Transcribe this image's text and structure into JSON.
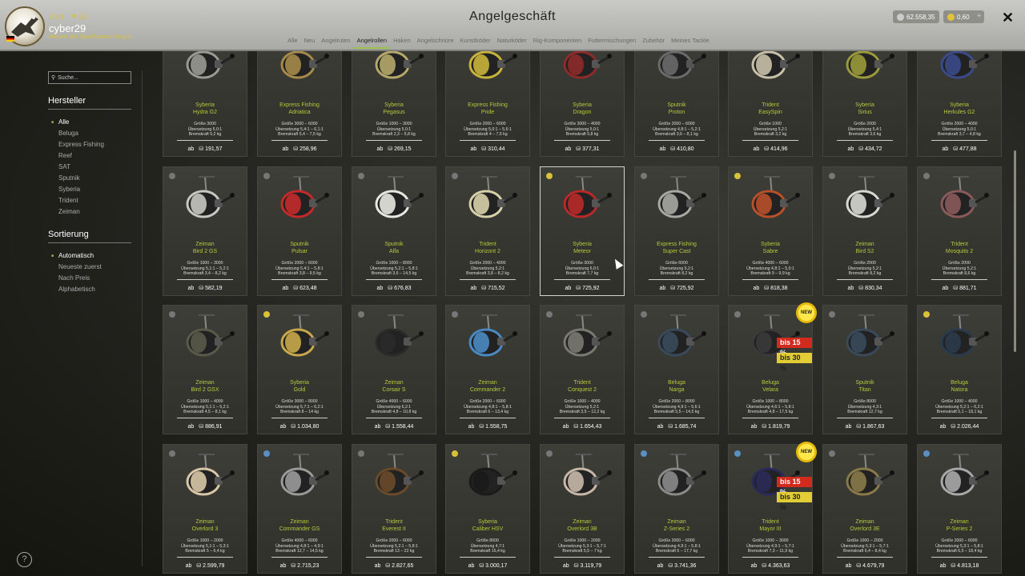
{
  "header": {
    "title": "Angelgeschäft",
    "user": {
      "name": "cyber29",
      "level": "41",
      "stars": "50",
      "rank": "Meister des Spinnfischen Rang 2"
    },
    "tabs": [
      "Alle",
      "Neu",
      "Angelruten",
      "Angelrollen",
      "Haken",
      "Angelschnüre",
      "Kunstköder",
      "Naturköder",
      "Rig-Komponenten",
      "Futtermischungen",
      "Zubehör",
      "Meines Tackle"
    ],
    "active_tab": "Angelrollen",
    "silver": "62.558,35",
    "gold": "0,60",
    "plus": "+",
    "close": "✕"
  },
  "sidebar": {
    "search_placeholder": "Suche...",
    "manufacturer_title": "Hersteller",
    "manufacturers": [
      "Alle",
      "Beluga",
      "Express Fishing",
      "Reef",
      "SAT",
      "Sputnik",
      "Syberia",
      "Trident",
      "Zeiman"
    ],
    "manufacturer_active": "Alle",
    "sort_title": "Sortierung",
    "sort_options": [
      "Automatisch",
      "Neueste zuerst",
      "Nach Preis",
      "Alphabetisch"
    ],
    "sort_active": "Automatisch",
    "help": "?"
  },
  "price_prefix": "ab",
  "discounts": {
    "d15": "bis 15 %",
    "d30": "bis 30 %",
    "new": "NEW"
  },
  "cards": [
    {
      "brand": "Syberia",
      "model": "Hydra G2",
      "size": "Größe 3000",
      "ratio": "Übersetzung 5,0:1",
      "drag": "Bremskraft 5,2 kg",
      "price": "191,57",
      "reel": "#9a9a94",
      "badge": ""
    },
    {
      "brand": "Express Fishing",
      "model": "Adriatica",
      "size": "Größe 3000 – 6000",
      "ratio": "Übersetzung 5,4:1 – 6,1:1",
      "drag": "Bremskraft 5,4 – 7,5 kg",
      "price": "258,96",
      "reel": "#a58a4a",
      "badge": ""
    },
    {
      "brand": "Syberia",
      "model": "Pegasus",
      "size": "Größe 1000 – 3000",
      "ratio": "Übersetzung 5,0:1",
      "drag": "Bremskraft 2,3 – 5,8 kg",
      "price": "269,15",
      "reel": "#b5a86a",
      "badge": ""
    },
    {
      "brand": "Express Fishing",
      "model": "Pride",
      "size": "Größe 2000 – 6000",
      "ratio": "Übersetzung 5,0:1 – 5,6:1",
      "drag": "Bremskraft 4 – 7,5 kg",
      "price": "310,44",
      "reel": "#c8b43a",
      "badge": ""
    },
    {
      "brand": "Syberia",
      "model": "Dragon",
      "size": "Größe 3000 – 4000",
      "ratio": "Übersetzung 5,0:1",
      "drag": "Bremskraft 5,8 kg",
      "price": "377,31",
      "reel": "#8e2a2a",
      "badge": ""
    },
    {
      "brand": "Sputnik",
      "model": "Proton",
      "size": "Größe 2000 – 6000",
      "ratio": "Übersetzung 4,8:1 – 5,2:1",
      "drag": "Bremskraft 3,6 – 8,1 kg",
      "price": "410,80",
      "reel": "#6a6a6a",
      "badge": ""
    },
    {
      "brand": "Trident",
      "model": "EasySpin",
      "size": "Größe 1000",
      "ratio": "Übersetzung 5,2:1",
      "drag": "Bremskraft 3,2 kg",
      "price": "414,96",
      "reel": "#c8c0a8",
      "badge": ""
    },
    {
      "brand": "Syberia",
      "model": "Sirius",
      "size": "Größe 2000",
      "ratio": "Übersetzung 5,4:1",
      "drag": "Bremskraft 3,6 kg",
      "price": "434,72",
      "reel": "#9a9a3a",
      "badge": ""
    },
    {
      "brand": "Syberia",
      "model": "Herkules G2",
      "size": "Größe 2000 – 4000",
      "ratio": "Übersetzung 5,0:1",
      "drag": "Bremskraft 3,7 – 4,8 kg",
      "price": "477,88",
      "reel": "#3a4a8a",
      "badge": ""
    },
    {
      "brand": "Zeiman",
      "model": "Bird 2 GS",
      "size": "Größe 1000 – 3000",
      "ratio": "Übersetzung 5,1:1 – 5,2:1",
      "drag": "Bremskraft 3,4 – 8,2 kg",
      "price": "582,19",
      "reel": "#c8c8c2",
      "badge": "grey"
    },
    {
      "brand": "Sputnik",
      "model": "Pulsar",
      "size": "Größe 2000 – 6000",
      "ratio": "Übersetzung 5,4:1 – 5,8:1",
      "drag": "Bremskraft 3,8 – 9,5 kg",
      "price": "623,48",
      "reel": "#c42a2a",
      "badge": "grey"
    },
    {
      "brand": "Sputnik",
      "model": "Alfa",
      "size": "Größe 1000 – 8000",
      "ratio": "Übersetzung 5,2:1 – 5,8:1",
      "drag": "Bremskraft 3,6 – 14,5 kg",
      "price": "676,83",
      "reel": "#e8e8e2",
      "badge": "grey"
    },
    {
      "brand": "Trident",
      "model": "Horizont 2",
      "size": "Größe 2000 – 4000",
      "ratio": "Übersetzung 5,2:1",
      "drag": "Bremskraft 3,8 – 8,2 kg",
      "price": "715,52",
      "reel": "#d8d0a8",
      "badge": "grey"
    },
    {
      "brand": "Syberia",
      "model": "Meteor",
      "size": "Größe 3000",
      "ratio": "Übersetzung 6,0:1",
      "drag": "Bremskraft 7,7 kg",
      "price": "725,92",
      "reel": "#b82a2a",
      "badge": "gold"
    },
    {
      "brand": "Express Fishing",
      "model": "Super Cast",
      "size": "Größe 6000",
      "ratio": "Übersetzung 5,2:1",
      "drag": "Bremskraft 8,2 kg",
      "price": "725,92",
      "reel": "#a8a8a2",
      "badge": "grey"
    },
    {
      "brand": "Syberia",
      "model": "Sabre",
      "size": "Größe 4000 – 6000",
      "ratio": "Übersetzung 4,8:1 – 5,0:1",
      "drag": "Bremskraft 9 – 9,9 kg",
      "price": "818,38",
      "reel": "#b8502a",
      "badge": "gold"
    },
    {
      "brand": "Zeiman",
      "model": "Bird S2",
      "size": "Größe 2000",
      "ratio": "Übersetzung 5,2:1",
      "drag": "Bremskraft 8,2 kg",
      "price": "830,34",
      "reel": "#d8d8d2",
      "badge": "grey"
    },
    {
      "brand": "Trident",
      "model": "Mosquito 2",
      "size": "Größe 2000",
      "ratio": "Übersetzung 5,2:1",
      "drag": "Bremskraft 8,6 kg",
      "price": "881,71",
      "reel": "#8a5a5a",
      "badge": "grey"
    },
    {
      "brand": "Zeiman",
      "model": "Bird 2 GSX",
      "size": "Größe 1000 – 4000",
      "ratio": "Übersetzung 5,1:1 – 5,2:1",
      "drag": "Bremskraft 4,5 – 8,1 kg",
      "price": "886,91",
      "reel": "#5a5a4a",
      "badge": "grey"
    },
    {
      "brand": "Syberia",
      "model": "Gold",
      "size": "Größe 3000 – 8000",
      "ratio": "Übersetzung 5,7:1 – 6,2:1",
      "drag": "Bremskraft 8 – 14 kg",
      "price": "1.034,80",
      "reel": "#c8a84a",
      "badge": "gold"
    },
    {
      "brand": "Zeiman",
      "model": "Corsair S",
      "size": "Größe 4000 – 6000",
      "ratio": "Übersetzung 6,2:1",
      "drag": "Bremskraft 4,8 – 10,8 kg",
      "price": "1.558,44",
      "reel": "#2a2a2a",
      "badge": "grey"
    },
    {
      "brand": "Zeiman",
      "model": "Commander 2",
      "size": "Größe 2000 – 6000",
      "ratio": "Übersetzung 4,8:1 – 5,8:1",
      "drag": "Bremskraft 6 – 13,4 kg",
      "price": "1.558,75",
      "reel": "#4a8ac2",
      "badge": "grey"
    },
    {
      "brand": "Trident",
      "model": "Conquest 2",
      "size": "Größe 1000 – 4000",
      "ratio": "Übersetzung 5,2:1",
      "drag": "Bremskraft 3,5 – 12,2 kg",
      "price": "1.654,43",
      "reel": "#7a7a72",
      "badge": "grey"
    },
    {
      "brand": "Beluga",
      "model": "Narga",
      "size": "Größe 2000 – 8000",
      "ratio": "Übersetzung 4,9:1 – 5,6:1",
      "drag": "Bremskraft 5,5 – 14,5 kg",
      "price": "1.685,74",
      "reel": "#3a4a5a",
      "badge": "grey"
    },
    {
      "brand": "Beluga",
      "model": "Velara",
      "size": "Größe 1000 – 8000",
      "ratio": "Übersetzung 4,6:1 – 5,8:1",
      "drag": "Bremskraft 4,8 – 17,5 kg",
      "price": "1.819,79",
      "reel": "#3a3a3a",
      "badge": "grey",
      "disc": true,
      "new": true
    },
    {
      "brand": "Sputnik",
      "model": "Titan",
      "size": "Größe 8000",
      "ratio": "Übersetzung 4,3:1",
      "drag": "Bremskraft 12,7 kg",
      "price": "1.867,63",
      "reel": "#3a4a5a",
      "badge": "grey"
    },
    {
      "brand": "Beluga",
      "model": "Natora",
      "size": "Größe 1000 – 4000",
      "ratio": "Übersetzung 5,2:1 – 6,2:1",
      "drag": "Bremskraft 5,1 – 18,1 kg",
      "price": "2.026,44",
      "reel": "#2a3a4a",
      "badge": "gold"
    },
    {
      "brand": "Zeiman",
      "model": "Overlord 3",
      "size": "Größe 1000 – 2000",
      "ratio": "Übersetzung 5,1:1 – 5,3:1",
      "drag": "Bremskraft 5 – 6,4 kg",
      "price": "2.599,79",
      "reel": "#d8c8a8",
      "badge": "grey"
    },
    {
      "brand": "Zeiman",
      "model": "Commander GS",
      "size": "Größe 4000 – 6000",
      "ratio": "Übersetzung 4,8:1 – 4,9:1",
      "drag": "Bremskraft 12,7 – 14,5 kg",
      "price": "2.715,23",
      "reel": "#9a9a9a",
      "badge": "blue"
    },
    {
      "brand": "Trident",
      "model": "Everest II",
      "size": "Größe 2000 – 6000",
      "ratio": "Übersetzung 5,2:1 – 5,8:1",
      "drag": "Bremskraft 13 – 22 kg",
      "price": "2.827,65",
      "reel": "#6a4a2a",
      "badge": "grey"
    },
    {
      "brand": "Syberia",
      "model": "Caliber HSV",
      "size": "Größe 8000",
      "ratio": "Übersetzung 4,7:1",
      "drag": "Bremskraft 15,4 kg",
      "price": "3.000,17",
      "reel": "#1a1a1a",
      "badge": "gold"
    },
    {
      "brand": "Zeiman",
      "model": "Overlord 3B",
      "size": "Größe 1000 – 2000",
      "ratio": "Übersetzung 5,3:1 – 5,7:1",
      "drag": "Bremskraft 5,5 – 7 kg",
      "price": "3.119,79",
      "reel": "#c8b8a8",
      "badge": "grey"
    },
    {
      "brand": "Zeiman",
      "model": "Z-Series 2",
      "size": "Größe 2000 – 6000",
      "ratio": "Übersetzung 4,9:1 – 5,8:1",
      "drag": "Bremskraft 6 – 17,7 kg",
      "price": "3.741,36",
      "reel": "#8a8a8a",
      "badge": "blue"
    },
    {
      "brand": "Trident",
      "model": "Mayor III",
      "size": "Größe 1000 – 3000",
      "ratio": "Übersetzung 4,9:1 – 5,7:1",
      "drag": "Bremskraft 7,3 – 11,9 kg",
      "price": "4.363,63",
      "reel": "#2a2a5a",
      "badge": "blue",
      "disc": true,
      "new": true
    },
    {
      "brand": "Zeiman",
      "model": "Overlord 3E",
      "size": "Größe 1000 – 2000",
      "ratio": "Übersetzung 5,3:1 – 5,7:1",
      "drag": "Bremskraft 6,4 – 8,4 kg",
      "price": "4.679,79",
      "reel": "#8a7a4a",
      "badge": "grey"
    },
    {
      "brand": "Zeiman",
      "model": "P-Series 2",
      "size": "Größe 2000 – 6000",
      "ratio": "Übersetzung 5,3:1 – 5,8:1",
      "drag": "Bremskraft 6,5 – 18,4 kg",
      "price": "4.813,18",
      "reel": "#a8a8a8",
      "badge": "blue"
    }
  ],
  "selected_card": 13
}
